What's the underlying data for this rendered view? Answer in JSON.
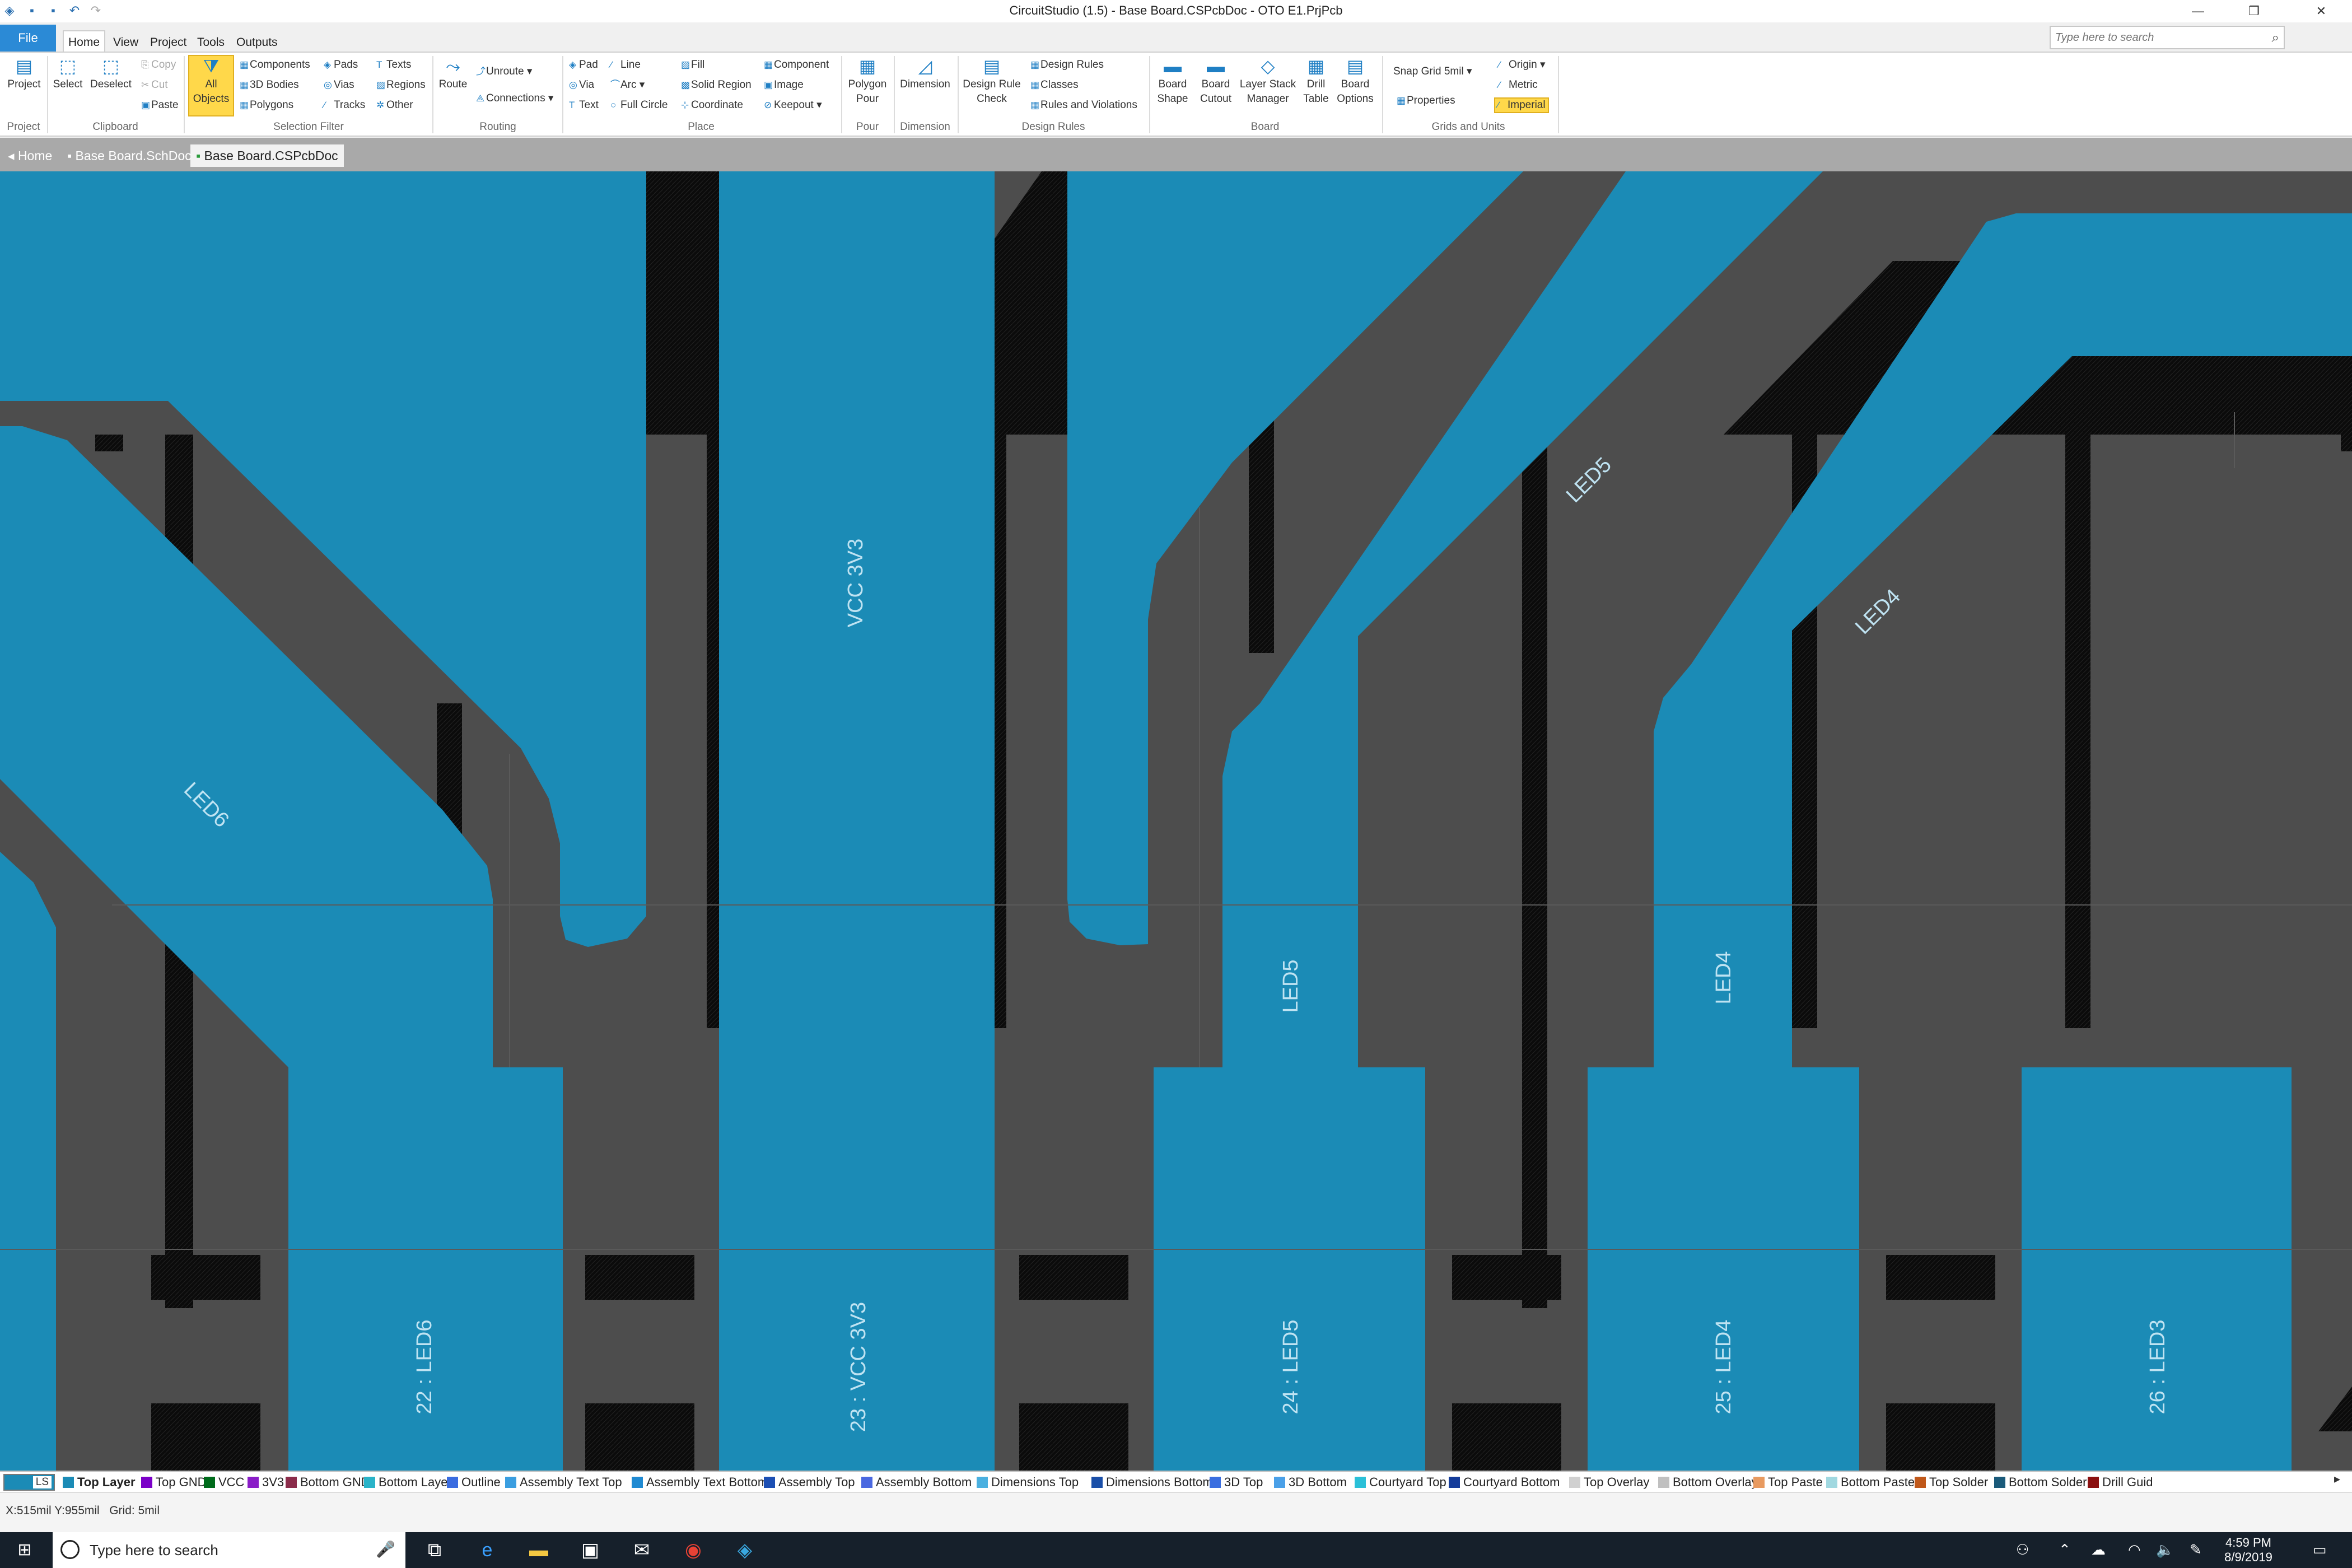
{
  "window": {
    "title": "CircuitStudio (1.5) - Base Board.CSPcbDoc - OTO E1.PrjPcb",
    "minimize": "—",
    "restore": "❐",
    "close": "✕"
  },
  "search": {
    "placeholder": "Type here to search"
  },
  "menu": {
    "file": "File",
    "tabs": [
      "Home",
      "View",
      "Project",
      "Tools",
      "Outputs"
    ]
  },
  "ribbon": {
    "project": {
      "button": "Project",
      "group": "Project"
    },
    "clipboard": {
      "select": "Select",
      "deselect": "Deselect",
      "copy": "Copy",
      "cut": "Cut",
      "paste": "Paste",
      "group": "Clipboard"
    },
    "selection_filter": {
      "all_objects_1": "All",
      "all_objects_2": "Objects",
      "components": "Components",
      "bodies": "3D Bodies",
      "polygons": "Polygons",
      "pads": "Pads",
      "vias": "Vias",
      "tracks": "Tracks",
      "texts": "Texts",
      "regions": "Regions",
      "other": "Other",
      "group": "Selection Filter"
    },
    "routing": {
      "route": "Route",
      "unroute": "Unroute",
      "connections": "Connections",
      "group": "Routing"
    },
    "place": {
      "pad": "Pad",
      "via": "Via",
      "text": "Text",
      "line": "Line",
      "arc": "Arc",
      "full_circle": "Full Circle",
      "fill": "Fill",
      "solid_region": "Solid Region",
      "coordinate": "Coordinate",
      "component": "Component",
      "image": "Image",
      "keepout": "Keepout",
      "group": "Place"
    },
    "pour": {
      "polygon_1": "Polygon",
      "polygon_2": "Pour",
      "group": "Pour"
    },
    "dimension": {
      "button": "Dimension",
      "group": "Dimension"
    },
    "design_rules": {
      "check_1": "Design Rule",
      "check_2": "Check",
      "rules": "Design Rules",
      "classes": "Classes",
      "violations": "Rules and Violations",
      "group": "Design Rules"
    },
    "board": {
      "shape_1": "Board",
      "shape_2": "Shape",
      "cutout_1": "Board",
      "cutout_2": "Cutout",
      "stack_1": "Layer Stack",
      "stack_2": "Manager",
      "drill_1": "Drill",
      "drill_2": "Table",
      "options_1": "Board",
      "options_2": "Options",
      "group": "Board"
    },
    "grids": {
      "snap_grid": "Snap Grid",
      "snap_value": "5mil",
      "properties": "Properties",
      "origin": "Origin",
      "metric": "Metric",
      "imperial": "Imperial",
      "group": "Grids and Units"
    }
  },
  "doc_tabs": [
    "Home",
    "Base Board.SchDoc",
    "Base Board.CSPcbDoc"
  ],
  "pcb": {
    "colors": {
      "copper": "#1b8bb6",
      "board": "#4d4d4d",
      "void": "#0b0b0b",
      "text": "#bfe3f2"
    },
    "track_labels": [
      "LED6",
      "VCC 3V3",
      "LED5",
      "LED4"
    ],
    "net_labels": [
      "LED5",
      "LED4"
    ],
    "pad_labels": [
      "22 : LED6",
      "23 : VCC 3V3",
      "24 : LED5",
      "25 : LED4",
      "26 : LED3"
    ]
  },
  "layers": {
    "ls": "LS",
    "tabs": [
      {
        "name": "Top Layer",
        "color": "#1b8bb6"
      },
      {
        "name": "Top GND",
        "color": "#7b00c8"
      },
      {
        "name": "VCC",
        "color": "#006b1b"
      },
      {
        "name": "3V3",
        "color": "#8a1dc8"
      },
      {
        "name": "Bottom GND",
        "color": "#8b2c4a"
      },
      {
        "name": "Bottom Layer",
        "color": "#2ab3c8"
      },
      {
        "name": "Outline",
        "color": "#3a6ce0"
      },
      {
        "name": "Assembly Text Top",
        "color": "#3a9ee0"
      },
      {
        "name": "Assembly Text Bottom",
        "color": "#1f8ad2"
      },
      {
        "name": "Assembly Top",
        "color": "#1c4fb3"
      },
      {
        "name": "Assembly Bottom",
        "color": "#4a68e0"
      },
      {
        "name": "Dimensions Top",
        "color": "#4ab0e0"
      },
      {
        "name": "Dimensions Bottom",
        "color": "#1a4fa8"
      },
      {
        "name": "3D Top",
        "color": "#3a6ee0"
      },
      {
        "name": "3D Bottom",
        "color": "#4aa0e8"
      },
      {
        "name": "Courtyard Top",
        "color": "#2ac0d8"
      },
      {
        "name": "Courtyard Bottom",
        "color": "#143c9a"
      },
      {
        "name": "Top Overlay",
        "color": "#d0d0d0"
      },
      {
        "name": "Bottom Overlay",
        "color": "#c0c0c0"
      },
      {
        "name": "Top Paste",
        "color": "#e89a60"
      },
      {
        "name": "Bottom Paste",
        "color": "#a0d8e0"
      },
      {
        "name": "Top Solder",
        "color": "#c0581a"
      },
      {
        "name": "Bottom Solder",
        "color": "#1a5a7a"
      },
      {
        "name": "Drill Guid",
        "color": "#8b1010"
      }
    ]
  },
  "status": {
    "coords": "X:515mil Y:955mil",
    "grid": "Grid: 5mil"
  },
  "taskbar": {
    "search_placeholder": "Type here to search",
    "time": "4:59 PM",
    "date": "8/9/2019"
  }
}
